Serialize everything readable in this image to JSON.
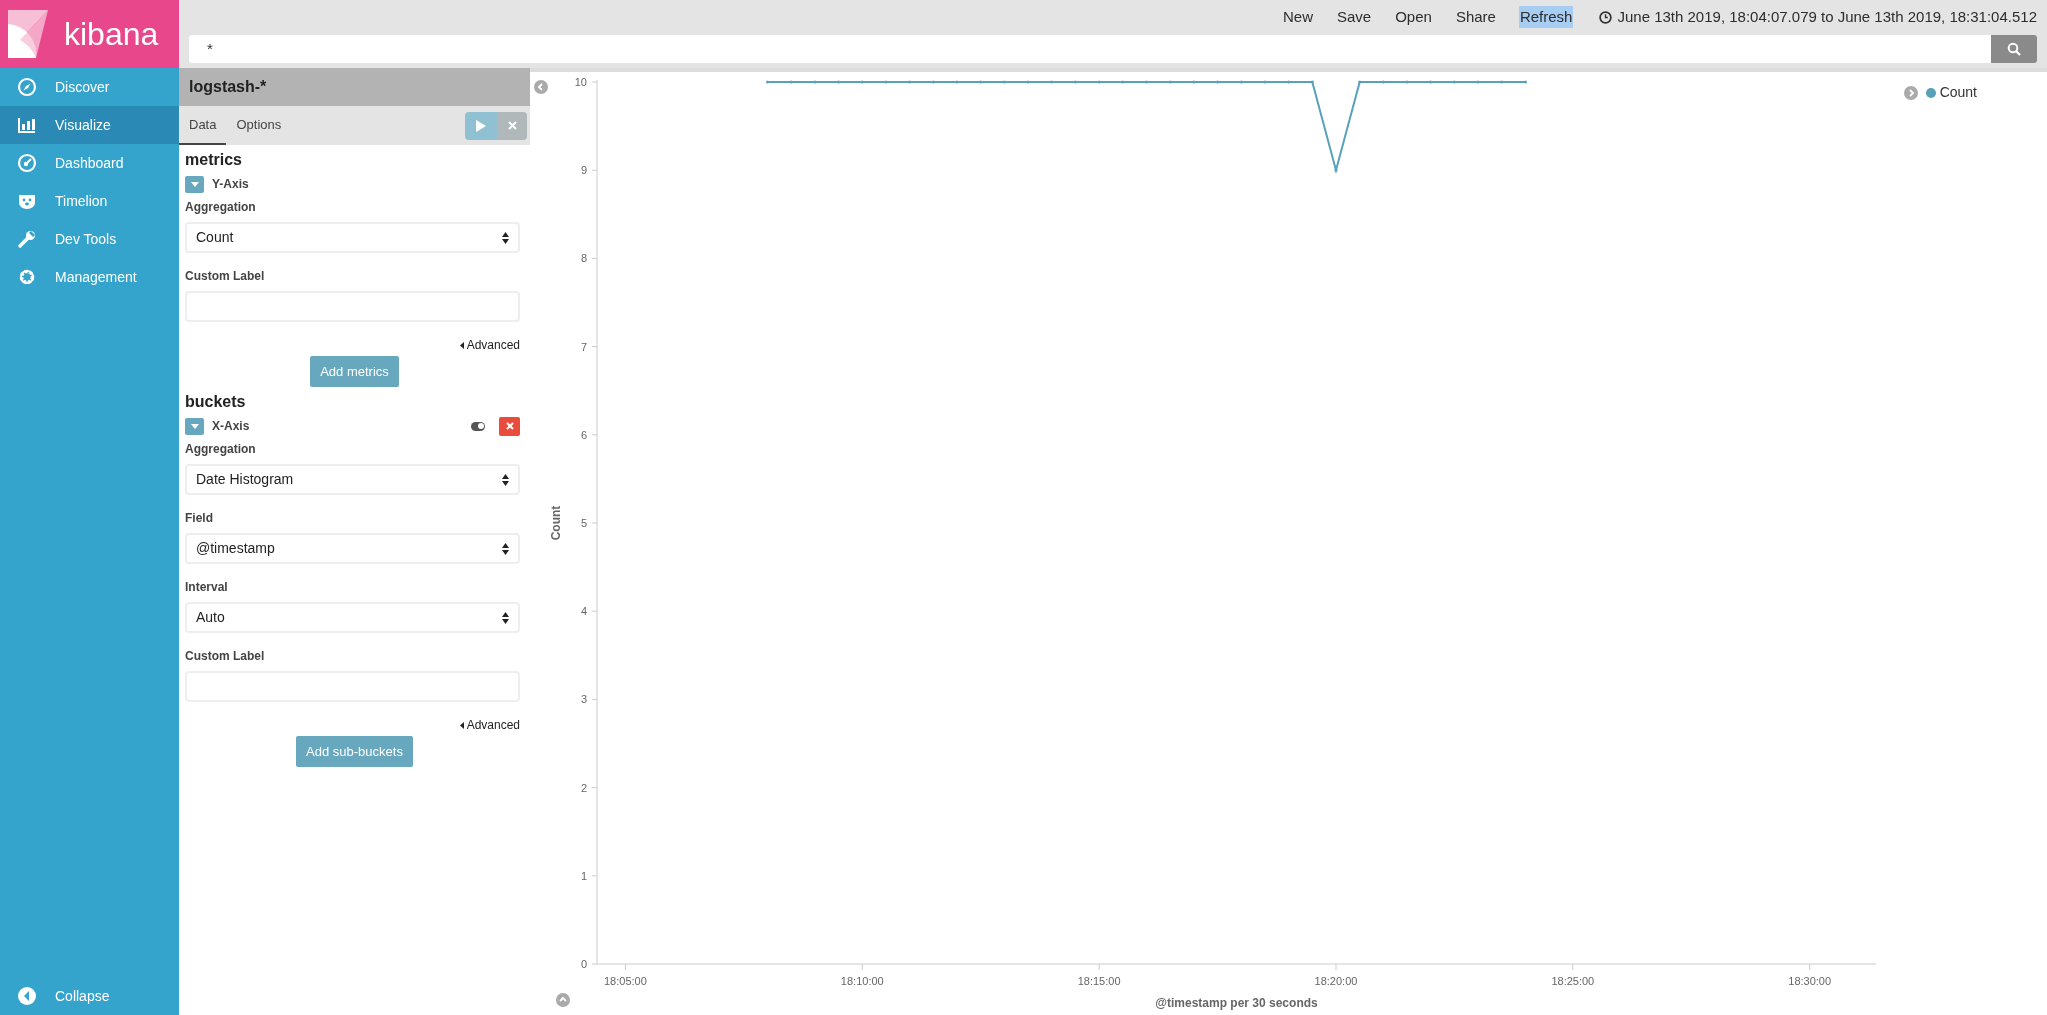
{
  "app": {
    "logo_text": "kibana"
  },
  "sidebar": {
    "items": [
      {
        "label": "Discover",
        "selected": false
      },
      {
        "label": "Visualize",
        "selected": true
      },
      {
        "label": "Dashboard",
        "selected": false
      },
      {
        "label": "Timelion",
        "selected": false
      },
      {
        "label": "Dev Tools",
        "selected": false
      },
      {
        "label": "Management",
        "selected": false
      }
    ],
    "collapse_label": "Collapse"
  },
  "top_menu": {
    "items": [
      {
        "label": "New",
        "highlighted": false
      },
      {
        "label": "Save",
        "highlighted": false
      },
      {
        "label": "Open",
        "highlighted": false
      },
      {
        "label": "Share",
        "highlighted": false
      },
      {
        "label": "Refresh",
        "highlighted": true
      }
    ],
    "time_range": "June 13th 2019, 18:04:07.079 to June 13th 2019, 18:31:04.512"
  },
  "search": {
    "value": "*"
  },
  "editor": {
    "index_pattern": "logstash-*",
    "tabs": [
      {
        "label": "Data",
        "selected": true
      },
      {
        "label": "Options",
        "selected": false
      }
    ],
    "sections": [
      {
        "title": "metrics",
        "aggs": [
          {
            "name": "Y-Axis",
            "removable": false,
            "fields": [
              {
                "kind": "select",
                "label": "Aggregation",
                "value": "Count"
              },
              {
                "kind": "text",
                "label": "Custom Label"
              }
            ],
            "advanced": "Advanced"
          }
        ],
        "add_button": "Add metrics"
      },
      {
        "title": "buckets",
        "aggs": [
          {
            "name": "X-Axis",
            "removable": true,
            "fields": [
              {
                "kind": "select",
                "label": "Aggregation",
                "value": "Date Histogram"
              },
              {
                "kind": "select",
                "label": "Field",
                "value": "@timestamp"
              },
              {
                "kind": "select",
                "label": "Interval",
                "value": "Auto"
              },
              {
                "kind": "text",
                "label": "Custom Label"
              }
            ],
            "advanced": "Advanced"
          }
        ],
        "add_button": "Add sub-buckets"
      }
    ]
  },
  "chart": {
    "chart_data": {
      "type": "line",
      "xlabel": "@timestamp per 30 seconds",
      "ylabel": "Count",
      "categories": [
        null,
        "18:05:00",
        null,
        null,
        null,
        null,
        null,
        null,
        null,
        null,
        null,
        "18:10:00",
        null,
        null,
        null,
        null,
        null,
        null,
        null,
        null,
        null,
        "18:15:00",
        null,
        null,
        null,
        null,
        null,
        null,
        null,
        null,
        null,
        "18:20:00",
        null,
        null,
        null,
        null,
        null,
        null,
        null,
        null,
        null,
        "18:25:00",
        null,
        null,
        null,
        null,
        null,
        null,
        null,
        null,
        null,
        "18:30:00",
        null,
        null
      ],
      "series": [
        {
          "name": "Count",
          "color": "#57a1b9",
          "values": [
            null,
            null,
            null,
            null,
            null,
            null,
            null,
            10,
            10,
            10,
            10,
            10,
            10,
            10,
            10,
            10,
            10,
            10,
            10,
            10,
            10,
            10,
            10,
            10,
            10,
            10,
            10,
            10,
            10,
            10,
            10,
            9,
            10,
            10,
            10,
            10,
            10,
            10,
            10,
            10,
            null,
            null,
            null,
            null,
            null,
            null,
            null,
            null,
            null,
            null,
            null,
            null,
            null,
            null
          ]
        }
      ],
      "ylim": [
        0,
        10
      ],
      "yticks": [
        0,
        1,
        2,
        3,
        4,
        5,
        6,
        7,
        8,
        9,
        10
      ]
    }
  }
}
